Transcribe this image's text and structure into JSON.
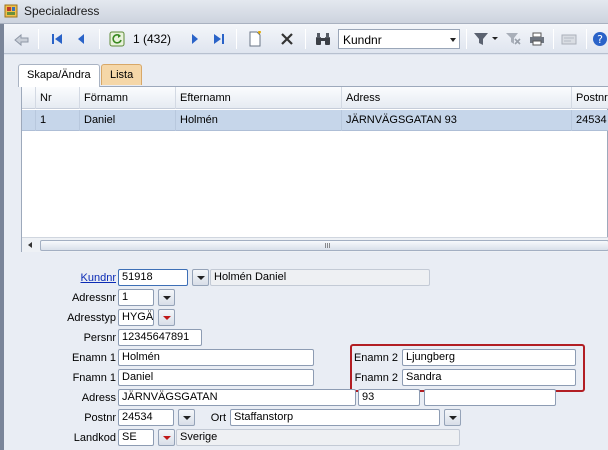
{
  "window": {
    "title": "Specialadress"
  },
  "toolbar": {
    "record_count": "1 (432)",
    "search_field_value": "Kundnr"
  },
  "tabs": [
    {
      "label": "Skapa/Ändra",
      "active": true
    },
    {
      "label": "Lista",
      "active": false
    }
  ],
  "grid": {
    "columns": [
      "Nr",
      "Förnamn",
      "Efternamn",
      "Adress",
      "Postnr"
    ],
    "rows": [
      [
        "1",
        "Daniel",
        "Holmén",
        "JÄRNVÄGSGATAN 93",
        "24534"
      ]
    ],
    "scroll_grip": "III"
  },
  "form": {
    "kundnr_label": "Kundnr",
    "kundnr_value": "51918",
    "kundnr_name": "Holmén Daniel",
    "adressnr_label": "Adressnr",
    "adressnr_value": "1",
    "adresstyp_label": "Adresstyp",
    "adresstyp_value": "HYGÄ",
    "persnr_label": "Persnr",
    "persnr_value": "12345647891",
    "enamn1_label": "Enamn 1",
    "enamn1_value": "Holmén",
    "fnamn1_label": "Fnamn 1",
    "fnamn1_value": "Daniel",
    "enamn2_label": "Enamn 2",
    "enamn2_value": "Ljungberg",
    "fnamn2_label": "Fnamn 2",
    "fnamn2_value": "Sandra",
    "adress_label": "Adress",
    "adress_value": "JÄRNVÄGSGATAN",
    "adress_number": "93",
    "adress_extra": "",
    "postnr_label": "Postnr",
    "postnr_value": "24534",
    "ort_label": "Ort",
    "ort_value": "Staffanstorp",
    "landkod_label": "Landkod",
    "landkod_value": "SE",
    "land_name": "Sverige"
  },
  "colors": {
    "highlight_border": "#b21e23",
    "selected_row": "#c6d6ea",
    "lista_tab": "#f5d7a8"
  },
  "icons": [
    "app-icon",
    "back-icon",
    "first-record-icon",
    "previous-record-icon",
    "refresh-icon",
    "next-record-icon",
    "last-record-icon",
    "new-record-icon",
    "delete-icon",
    "binoculars-icon",
    "filter-icon",
    "clear-filter-icon",
    "print-icon",
    "disabled-action-icon",
    "help-icon"
  ]
}
